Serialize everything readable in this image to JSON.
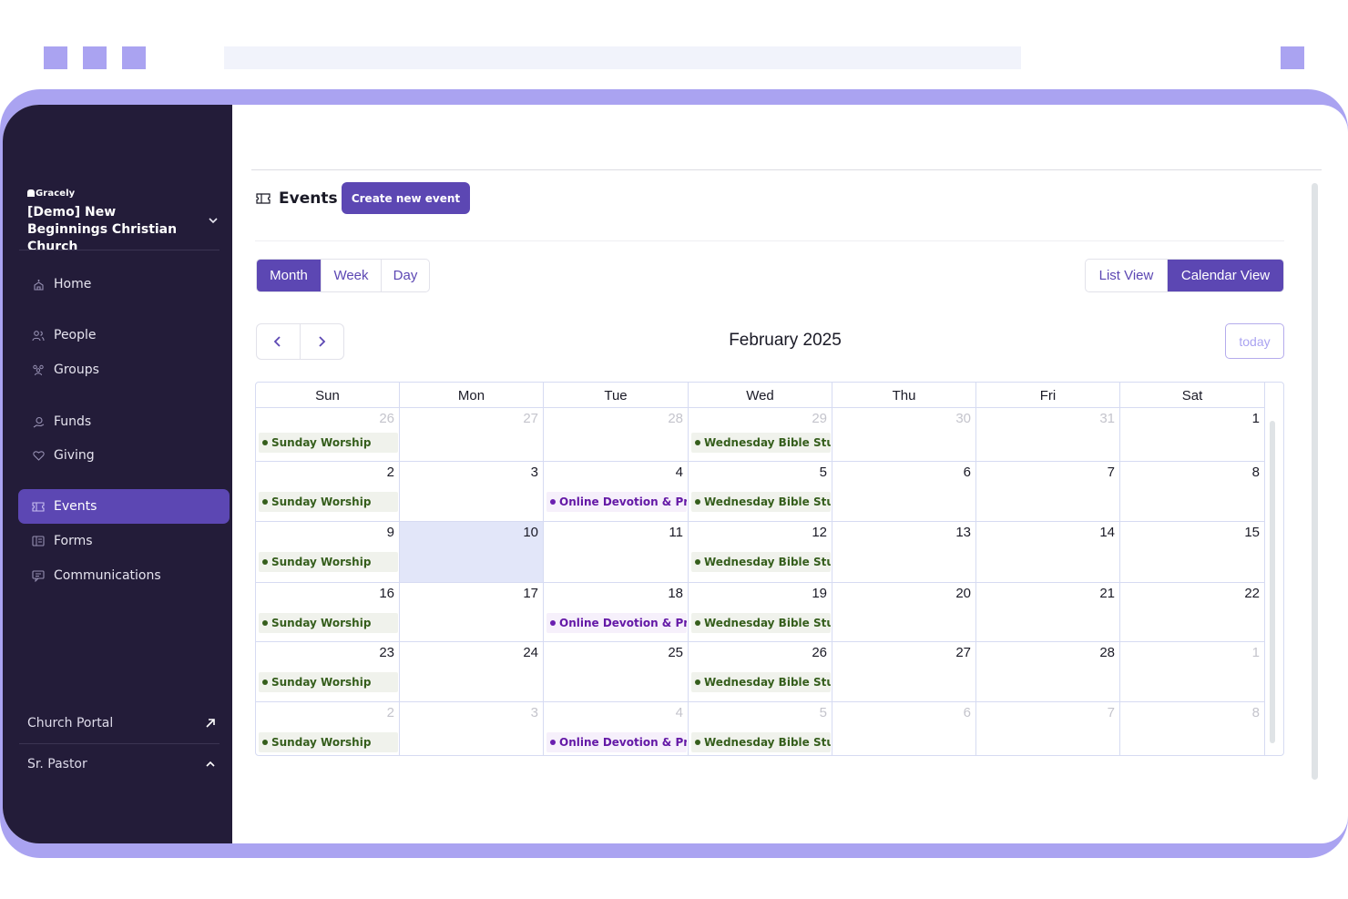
{
  "brand": {
    "logo": "Gracely",
    "org_name": "[Demo] New Beginnings Christian Church"
  },
  "sidebar": {
    "items": [
      {
        "label": "Home",
        "icon": "church-icon"
      },
      {
        "label": "People",
        "icon": "people-icon"
      },
      {
        "label": "Groups",
        "icon": "groups-icon"
      },
      {
        "label": "Funds",
        "icon": "funds-icon"
      },
      {
        "label": "Giving",
        "icon": "heart-icon"
      },
      {
        "label": "Events",
        "icon": "ticket-icon",
        "active": true
      },
      {
        "label": "Forms",
        "icon": "forms-icon"
      },
      {
        "label": "Communications",
        "icon": "chat-icon"
      }
    ],
    "portal_label": "Church Portal",
    "user_label": "Sr. Pastor"
  },
  "page": {
    "title": "Events",
    "create_button": "Create new event"
  },
  "view_modes": {
    "month": "Month",
    "week": "Week",
    "day": "Day",
    "active": "Month"
  },
  "layout_toggle": {
    "list": "List View",
    "calendar": "Calendar View",
    "active": "Calendar View"
  },
  "calendar": {
    "title": "February 2025",
    "today_label": "today",
    "weekdays": [
      "Sun",
      "Mon",
      "Tue",
      "Wed",
      "Thu",
      "Fri",
      "Sat"
    ],
    "weeks": [
      [
        {
          "n": "26",
          "m": true,
          "ev": [
            "Sunday Worship"
          ]
        },
        {
          "n": "27",
          "m": true
        },
        {
          "n": "28",
          "m": true
        },
        {
          "n": "29",
          "m": true,
          "ev": [
            "Wednesday Bible Study"
          ]
        },
        {
          "n": "30",
          "m": true
        },
        {
          "n": "31",
          "m": true
        },
        {
          "n": "1"
        }
      ],
      [
        {
          "n": "2",
          "ev": [
            "Sunday Worship"
          ]
        },
        {
          "n": "3"
        },
        {
          "n": "4",
          "ev": [
            "Online Devotion & Prayer"
          ]
        },
        {
          "n": "5",
          "ev": [
            "Wednesday Bible Study"
          ]
        },
        {
          "n": "6"
        },
        {
          "n": "7"
        },
        {
          "n": "8"
        }
      ],
      [
        {
          "n": "9",
          "ev": [
            "Sunday Worship"
          ]
        },
        {
          "n": "10",
          "today": true
        },
        {
          "n": "11"
        },
        {
          "n": "12",
          "ev": [
            "Wednesday Bible Study"
          ]
        },
        {
          "n": "13"
        },
        {
          "n": "14"
        },
        {
          "n": "15"
        }
      ],
      [
        {
          "n": "16",
          "ev": [
            "Sunday Worship"
          ]
        },
        {
          "n": "17"
        },
        {
          "n": "18",
          "ev": [
            "Online Devotion & Prayer"
          ]
        },
        {
          "n": "19",
          "ev": [
            "Wednesday Bible Study"
          ]
        },
        {
          "n": "20"
        },
        {
          "n": "21"
        },
        {
          "n": "22"
        }
      ],
      [
        {
          "n": "23",
          "ev": [
            "Sunday Worship"
          ]
        },
        {
          "n": "24"
        },
        {
          "n": "25"
        },
        {
          "n": "26",
          "ev": [
            "Wednesday Bible Study"
          ]
        },
        {
          "n": "27"
        },
        {
          "n": "28"
        },
        {
          "n": "1",
          "m": true
        }
      ],
      [
        {
          "n": "2",
          "m": true,
          "ev": [
            "Sunday Worship"
          ]
        },
        {
          "n": "3",
          "m": true
        },
        {
          "n": "4",
          "m": true,
          "ev": [
            "Online Devotion & Prayer"
          ]
        },
        {
          "n": "5",
          "m": true,
          "ev": [
            "Wednesday Bible Study"
          ]
        },
        {
          "n": "6",
          "m": true
        },
        {
          "n": "7",
          "m": true
        },
        {
          "n": "8",
          "m": true
        }
      ]
    ]
  },
  "colors": {
    "accent": "#5c47b3",
    "sidebar_bg": "#231c39",
    "frame": "#aaa3f1",
    "event_green": "#355e1c",
    "event_purple": "#6419a6",
    "today_bg": "#e2e6f9"
  }
}
